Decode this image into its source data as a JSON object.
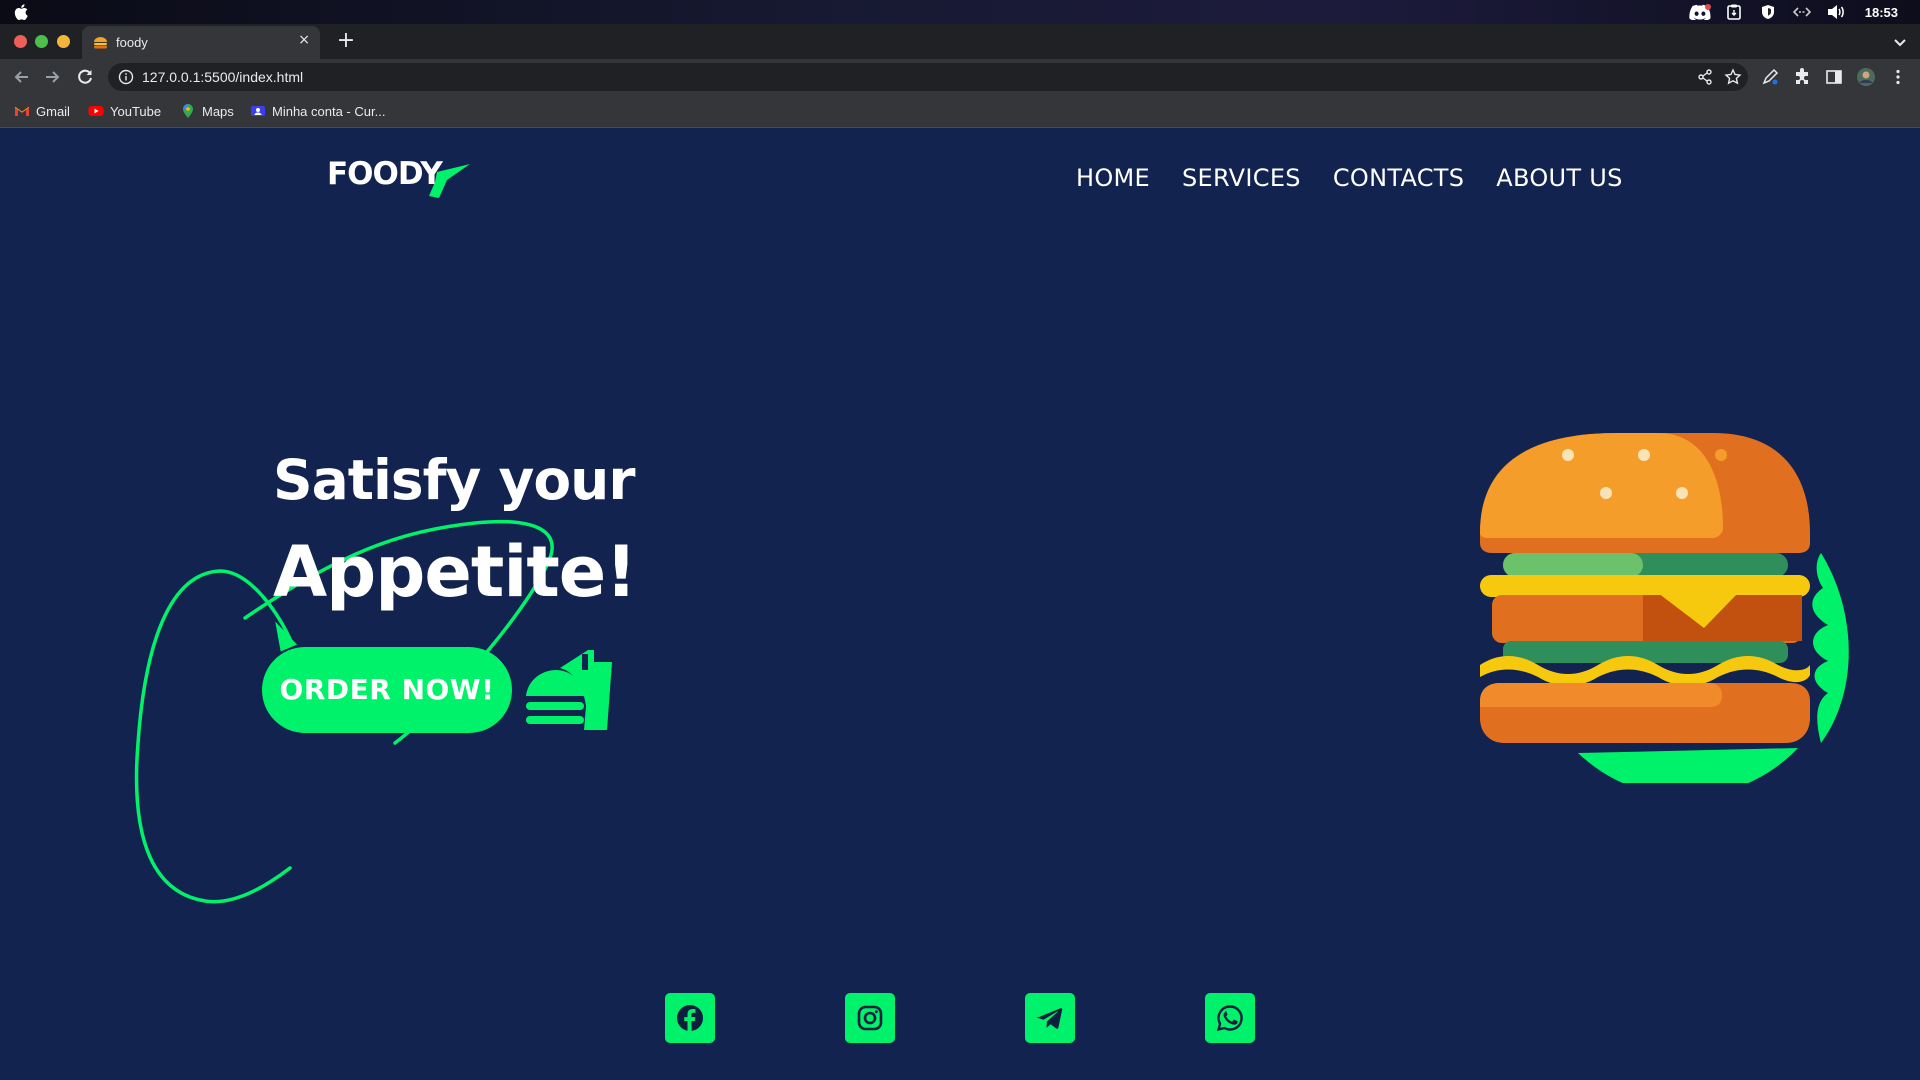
{
  "os": {
    "clock": "18:53",
    "tray_icons": [
      "discord-icon",
      "clipboard-icon",
      "shield-icon",
      "network-icon",
      "volume-icon"
    ]
  },
  "browser": {
    "tab": {
      "title": "foody",
      "close_glyph": "×"
    },
    "new_tab_glyph": "+",
    "url": "127.0.0.1:5500/index.html",
    "bookmarks": [
      {
        "label": "Gmail",
        "icon": "gmail-icon"
      },
      {
        "label": "YouTube",
        "icon": "youtube-icon"
      },
      {
        "label": "Maps",
        "icon": "maps-icon"
      },
      {
        "label": "Minha conta - Cur...",
        "icon": "account-icon"
      }
    ]
  },
  "site": {
    "logo_text": "FOODY",
    "nav": [
      "HOME",
      "SERVICES",
      "CONTACTS",
      "ABOUT US"
    ],
    "hero": {
      "line1": "Satisfy your",
      "line2": "Appetite!",
      "cta": "ORDER NOW!"
    },
    "socials": [
      "facebook-icon",
      "instagram-icon",
      "telegram-icon",
      "whatsapp-icon"
    ]
  },
  "colors": {
    "page_bg": "#12234f",
    "accent": "#00f26a",
    "text": "#ffffff"
  }
}
